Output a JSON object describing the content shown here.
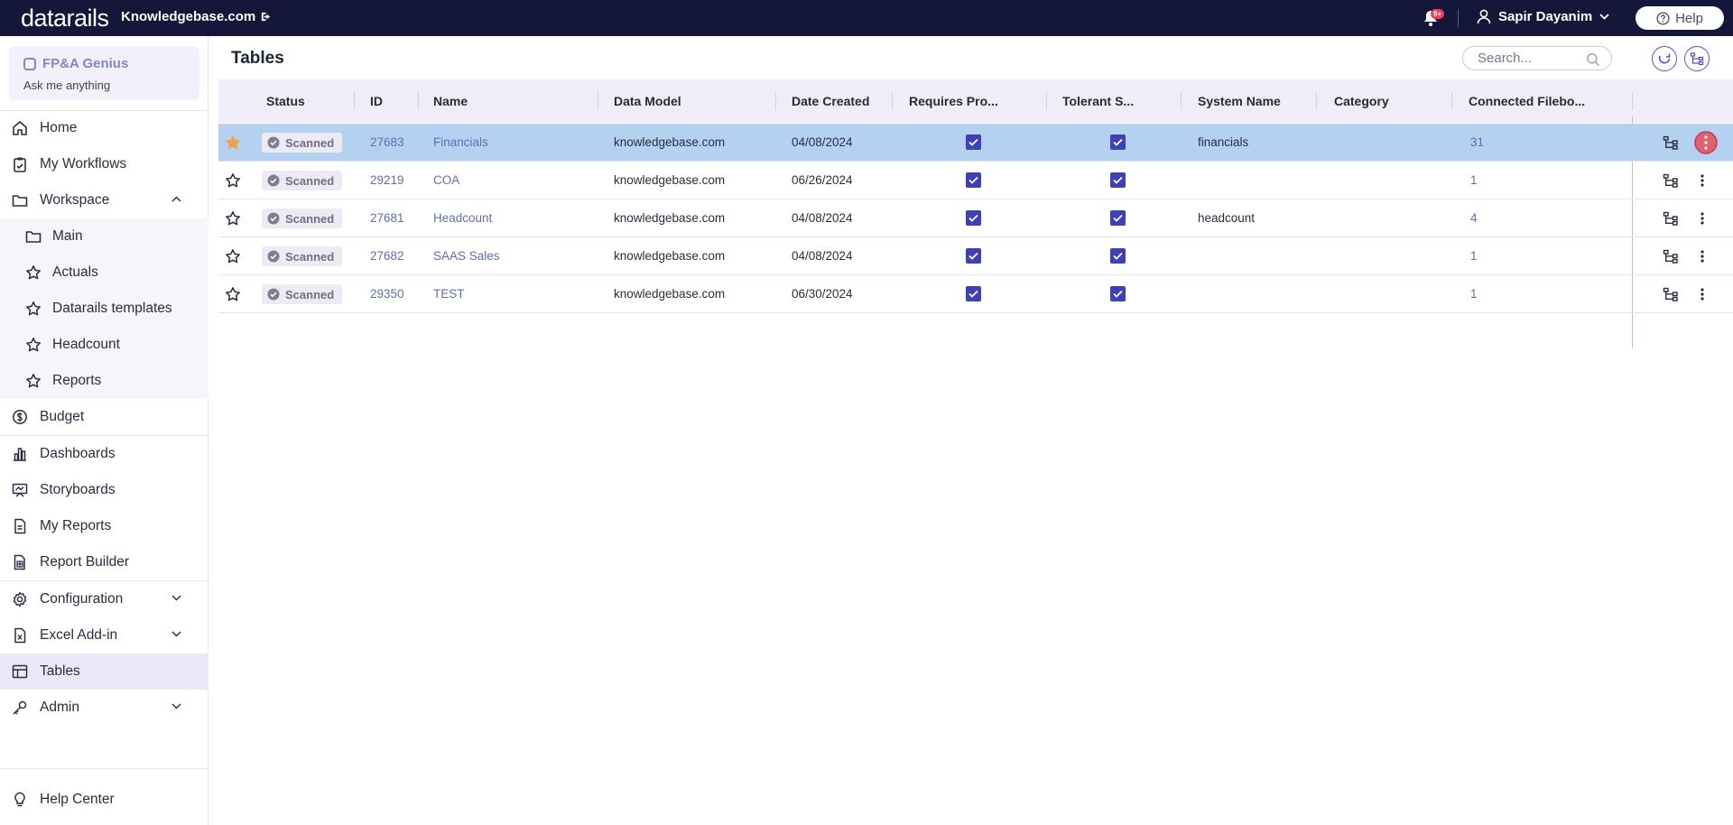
{
  "topbar": {
    "logo": "datarails",
    "company": "Knowledgebase.com",
    "notifications_badge": "9+",
    "user_name": "Sapir Dayanim",
    "help_label": "Help"
  },
  "genius": {
    "title": "FP&A Genius",
    "subtitle": "Ask me anything"
  },
  "sidebar": {
    "items": [
      {
        "label": "Home",
        "icon": "home-icon"
      },
      {
        "label": "My Workflows",
        "icon": "clipboard-icon"
      },
      {
        "label": "Workspace",
        "icon": "folder-icon",
        "expanded": true
      },
      {
        "label": "Main",
        "icon": "folder-icon"
      },
      {
        "label": "Actuals",
        "icon": "star-icon"
      },
      {
        "label": "Datarails templates",
        "icon": "star-icon"
      },
      {
        "label": "Headcount",
        "icon": "star-icon"
      },
      {
        "label": "Reports",
        "icon": "star-icon"
      },
      {
        "label": "Budget",
        "icon": "budget-icon"
      },
      {
        "label": "Dashboards",
        "icon": "bar-chart-icon"
      },
      {
        "label": "Storyboards",
        "icon": "presentation-icon"
      },
      {
        "label": "My Reports",
        "icon": "report-icon"
      },
      {
        "label": "Report Builder",
        "icon": "report-builder-icon"
      },
      {
        "label": "Configuration",
        "icon": "gear-icon"
      },
      {
        "label": "Excel Add-in",
        "icon": "excel-icon"
      },
      {
        "label": "Tables",
        "icon": "table-icon",
        "active": true
      },
      {
        "label": "Admin",
        "icon": "key-icon"
      }
    ],
    "help_center": "Help Center"
  },
  "page": {
    "title": "Tables",
    "search_placeholder": "Search..."
  },
  "table": {
    "columns": [
      "Status",
      "ID",
      "Name",
      "Data Model",
      "Date Created",
      "Requires Pro...",
      "Tolerant S...",
      "System Name",
      "Category",
      "Connected Filebo..."
    ],
    "rows": [
      {
        "starred": true,
        "status": "Scanned",
        "id": "27683",
        "name": "Financials",
        "data_model": "knowledgebase.com",
        "date": "04/08/2024",
        "requires": true,
        "tolerant": true,
        "system_name": "financials",
        "category": "",
        "connected": "31",
        "selected": true
      },
      {
        "starred": false,
        "status": "Scanned",
        "id": "29219",
        "name": "COA",
        "data_model": "knowledgebase.com",
        "date": "06/26/2024",
        "requires": true,
        "tolerant": true,
        "system_name": "",
        "category": "",
        "connected": "1"
      },
      {
        "starred": false,
        "status": "Scanned",
        "id": "27681",
        "name": "Headcount",
        "data_model": "knowledgebase.com",
        "date": "04/08/2024",
        "requires": true,
        "tolerant": true,
        "system_name": "headcount",
        "category": "",
        "connected": "4"
      },
      {
        "starred": false,
        "status": "Scanned",
        "id": "27682",
        "name": "SAAS Sales",
        "data_model": "knowledgebase.com",
        "date": "04/08/2024",
        "requires": true,
        "tolerant": true,
        "system_name": "",
        "category": "",
        "connected": "1"
      },
      {
        "starred": false,
        "status": "Scanned",
        "id": "29350",
        "name": "TEST",
        "data_model": "knowledgebase.com",
        "date": "06/30/2024",
        "requires": true,
        "tolerant": true,
        "system_name": "",
        "category": "",
        "connected": "1"
      }
    ]
  },
  "colors": {
    "topbar": "#14163a",
    "accent": "#3f3fb8",
    "selected_row": "#b5d1f1",
    "star_filled": "#f0a24a"
  }
}
